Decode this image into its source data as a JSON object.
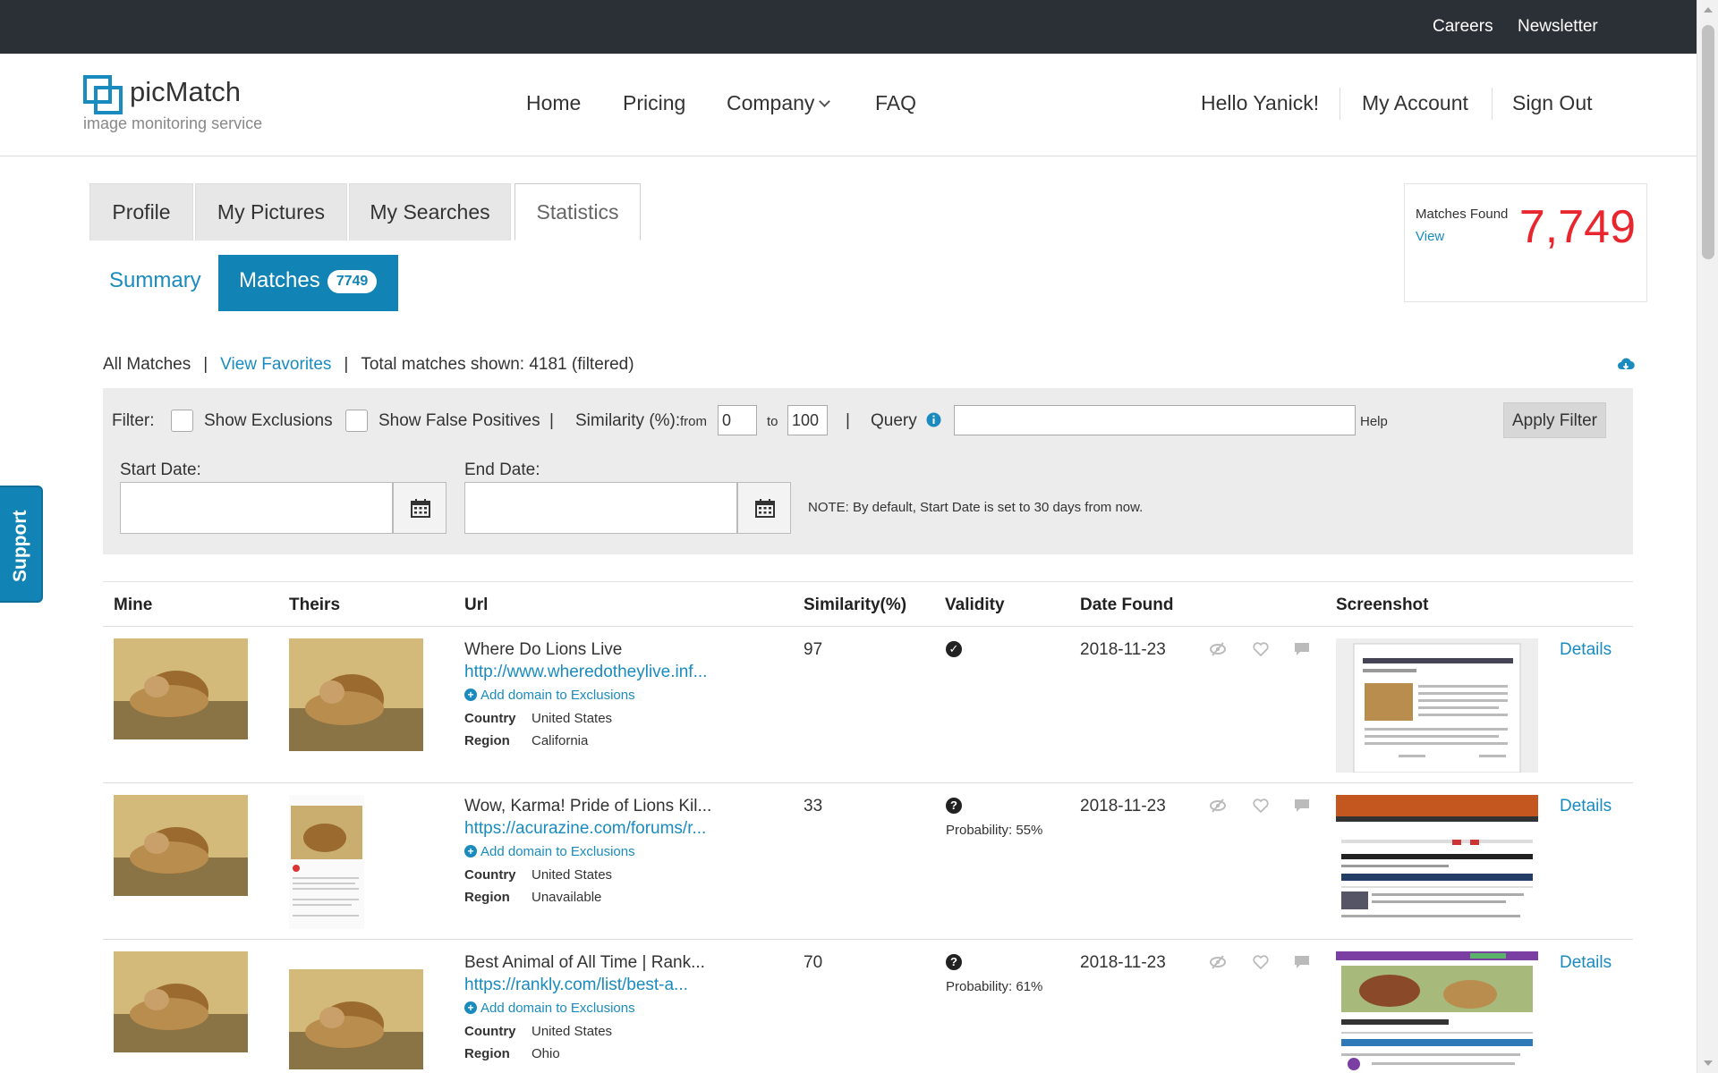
{
  "topbar": {
    "careers": "Careers",
    "newsletter": "Newsletter"
  },
  "brand": {
    "name": "picMatch",
    "tagline": "image monitoring service"
  },
  "nav": {
    "home": "Home",
    "pricing": "Pricing",
    "company": "Company",
    "faq": "FAQ"
  },
  "user": {
    "greeting": "Hello Yanick!",
    "account": "My Account",
    "signout": "Sign Out"
  },
  "tabs": [
    "Profile",
    "My Pictures",
    "My Searches",
    "Statistics"
  ],
  "subtabs": {
    "summary": "Summary",
    "matches": "Matches",
    "matches_count": "7749"
  },
  "matches_box": {
    "label": "Matches Found",
    "view": "View",
    "count": "7,749"
  },
  "list_header": {
    "all": "All Matches",
    "favorites": "View Favorites",
    "total": "Total matches shown: 4181 (filtered)"
  },
  "filter": {
    "label": "Filter:",
    "show_exclusions": "Show Exclusions",
    "show_false_positives": "Show False Positives",
    "similarity": "Similarity (%):",
    "from": "from",
    "from_value": "0",
    "to": "to",
    "to_value": "100",
    "query": "Query",
    "query_value": "",
    "help": "Help",
    "apply": "Apply Filter",
    "start_date": "Start Date:",
    "end_date": "End Date:",
    "note": "NOTE: By default, Start Date is set to 30 days from now."
  },
  "support": "Support",
  "table": {
    "headers": {
      "mine": "Mine",
      "theirs": "Theirs",
      "url": "Url",
      "similarity": "Similarity(%)",
      "validity": "Validity",
      "date": "Date Found",
      "screenshot": "Screenshot"
    },
    "add_exclusion": "Add domain to Exclusions",
    "country_label": "Country",
    "region_label": "Region",
    "details": "Details",
    "rows": [
      {
        "title": "Where Do Lions Live",
        "url": "http://www.wheredotheylive.inf...",
        "similarity": "97",
        "validity": "valid",
        "probability": "",
        "date": "2018-11-23",
        "country": "United States",
        "region": "California"
      },
      {
        "title": "Wow, Karma! Pride of Lions Kil...",
        "url": "https://acurazine.com/forums/r...",
        "similarity": "33",
        "validity": "unknown",
        "probability": "Probability: 55%",
        "date": "2018-11-23",
        "country": "United States",
        "region": "Unavailable"
      },
      {
        "title": "Best Animal of All Time | Rank...",
        "url": "https://rankly.com/list/best-a...",
        "similarity": "70",
        "validity": "unknown",
        "probability": "Probability: 61%",
        "date": "2018-11-23",
        "country": "United States",
        "region": "Ohio"
      }
    ]
  },
  "colors": {
    "accent": "#1283b5",
    "topbar": "#2b2f36",
    "count_red": "#e8262e"
  }
}
